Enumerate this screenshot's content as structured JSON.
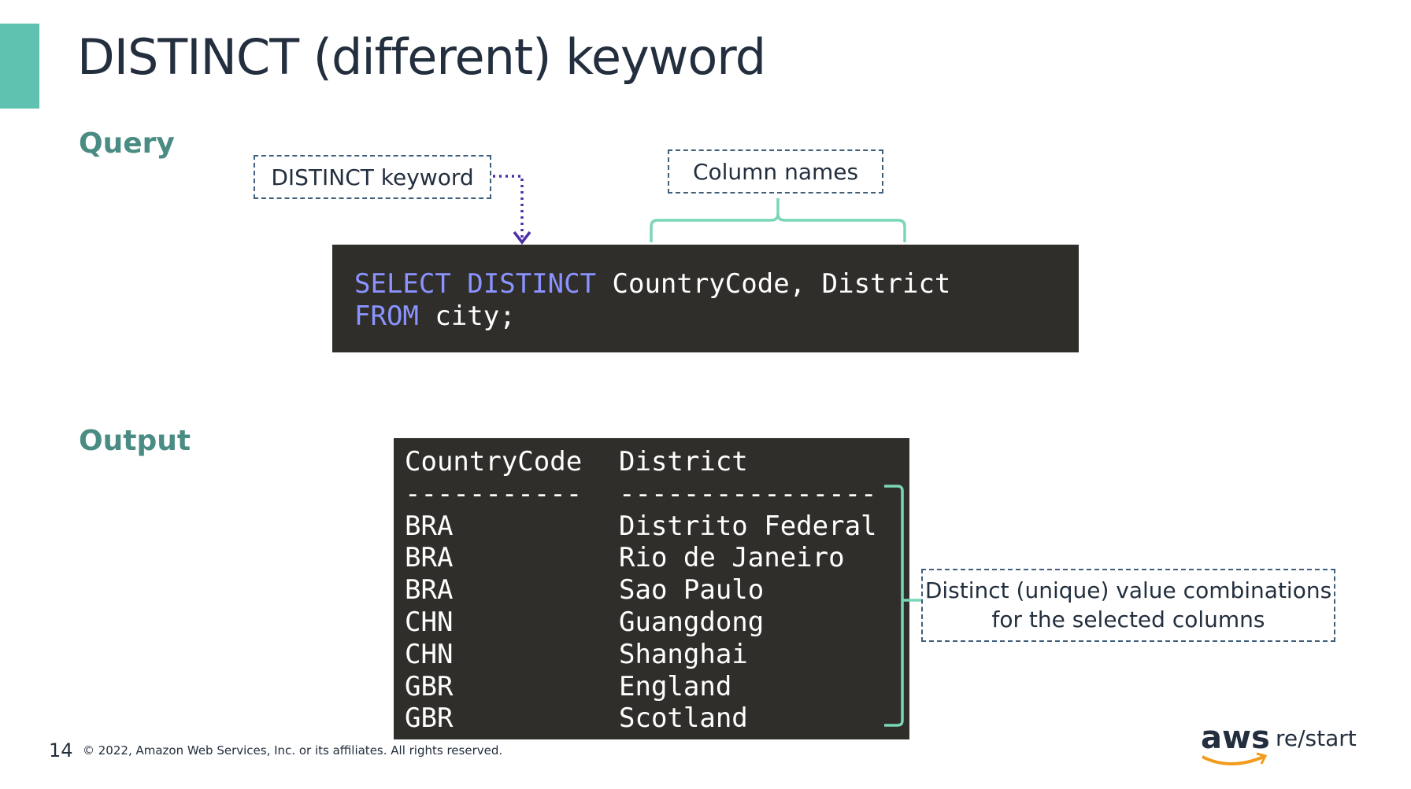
{
  "slide": {
    "title": "DISTINCT (different) keyword",
    "page_number": "14",
    "copyright": "© 2022, Amazon Web Services, Inc. or its affiliates. All rights reserved.",
    "logo_text": "aws",
    "logo_suffix": "re/start",
    "accent_color": "#5fc1b0"
  },
  "query": {
    "label": "Query",
    "callout_distinct": "DISTINCT keyword",
    "callout_columns": "Column names",
    "line1_kw": "SELECT DISTINCT",
    "line1_rest": " CountryCode, District",
    "line2_kw": "FROM",
    "line2_rest": " city;"
  },
  "output": {
    "label": "Output",
    "header": [
      "CountryCode",
      "District"
    ],
    "separator": [
      "-----------",
      "----------------"
    ],
    "rows": [
      [
        "BRA",
        "Distrito Federal"
      ],
      [
        "BRA",
        "Rio de Janeiro"
      ],
      [
        "BRA",
        "Sao Paulo"
      ],
      [
        "CHN",
        "Guangdong"
      ],
      [
        "CHN",
        "Shanghai"
      ],
      [
        "GBR",
        "England"
      ],
      [
        "GBR",
        "Scotland"
      ]
    ],
    "callout_line1": "Distinct (unique) value combinations",
    "callout_line2": "for the selected columns"
  }
}
